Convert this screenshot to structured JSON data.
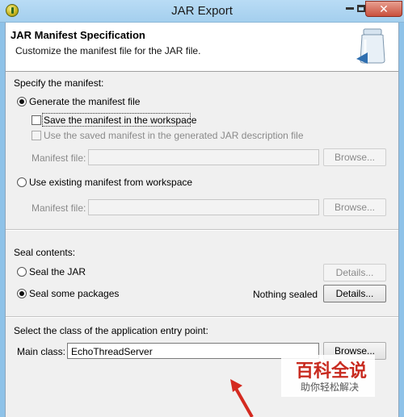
{
  "window": {
    "title": "JAR Export",
    "close_glyph": "✕"
  },
  "header": {
    "title": "JAR Manifest Specification",
    "description": "Customize the manifest file for the JAR file."
  },
  "manifest_section": {
    "label": "Specify the manifest:",
    "generate_label": "Generate the manifest file",
    "save_label": "Save the manifest in the workspace",
    "use_saved_label": "Use the saved manifest in the generated JAR description file",
    "manifest_file_label": "Manifest file:",
    "manifest_file_value": "",
    "browse_label": "Browse...",
    "use_existing_label": "Use existing manifest from workspace",
    "manifest_file2_label": "Manifest file:",
    "manifest_file2_value": "",
    "browse2_label": "Browse..."
  },
  "seal_section": {
    "label": "Seal contents:",
    "seal_jar_label": "Seal the JAR",
    "details1_label": "Details...",
    "seal_some_label": "Seal some packages",
    "status": "Nothing sealed",
    "details2_label": "Details..."
  },
  "entry_section": {
    "label": "Select the class of the application entry point:",
    "main_class_label": "Main class:",
    "main_class_value": "EchoThreadServer",
    "browse_label": "Browse..."
  },
  "watermark": {
    "text": "百科全说",
    "sub": "助你轻松解决"
  },
  "state": {
    "generate_selected": true,
    "use_existing_selected": false,
    "seal_jar_selected": false,
    "seal_some_selected": true,
    "save_checked": false,
    "use_saved_checked": false
  }
}
